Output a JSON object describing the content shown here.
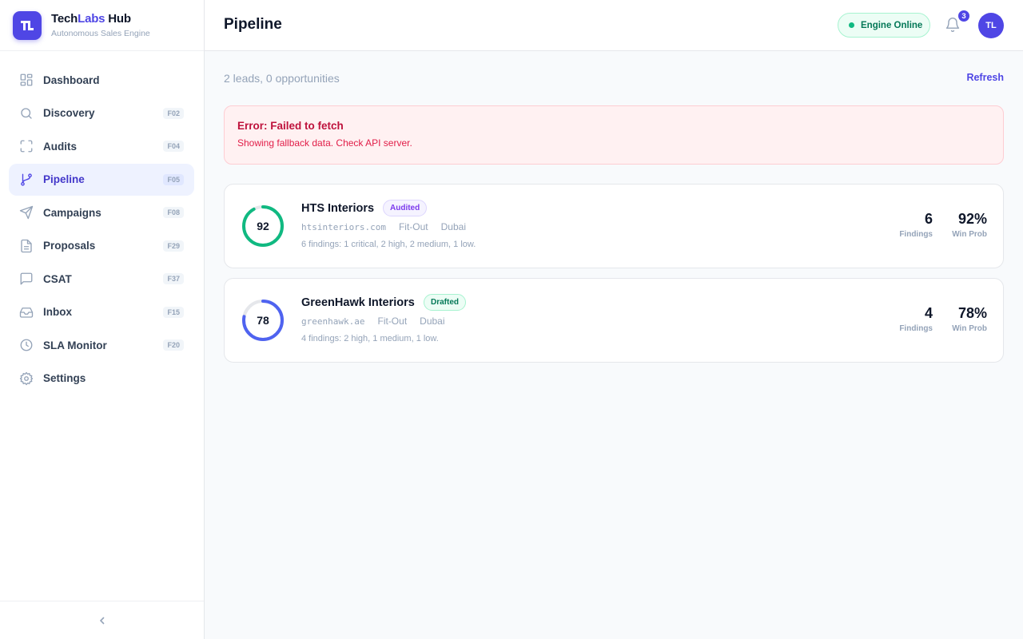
{
  "brand": {
    "name_part1": "Tech",
    "name_accent": "Labs",
    "name_part2": " Hub",
    "subtitle": "Autonomous Sales Engine",
    "logo_text": "TL"
  },
  "sidebar": {
    "items": [
      {
        "label": "Dashboard",
        "kbd": "",
        "icon": "dashboard-icon"
      },
      {
        "label": "Discovery",
        "kbd": "F02",
        "icon": "search-icon"
      },
      {
        "label": "Audits",
        "kbd": "F04",
        "icon": "scan-icon"
      },
      {
        "label": "Pipeline",
        "kbd": "F05",
        "icon": "git-branch-icon",
        "active": true
      },
      {
        "label": "Campaigns",
        "kbd": "F08",
        "icon": "send-icon"
      },
      {
        "label": "Proposals",
        "kbd": "F29",
        "icon": "file-text-icon"
      },
      {
        "label": "CSAT",
        "kbd": "F37",
        "icon": "message-square-icon"
      },
      {
        "label": "Inbox",
        "kbd": "F15",
        "icon": "inbox-icon"
      },
      {
        "label": "SLA Monitor",
        "kbd": "F20",
        "icon": "clock-icon"
      },
      {
        "label": "Settings",
        "kbd": "",
        "icon": "gear-icon"
      }
    ],
    "collapse_icon": "chevron-left-icon"
  },
  "header": {
    "title": "Pipeline",
    "status": "Engine Online",
    "notifications": "3",
    "avatar": "TL"
  },
  "main": {
    "summary": "2 leads, 0 opportunities",
    "refresh_label": "Refresh",
    "error": {
      "title": "Error: Failed to fetch",
      "message": "Showing fallback data. Check API server."
    },
    "leads": [
      {
        "score": "92",
        "score_value": 92,
        "ring_color": "#10b981",
        "name": "HTS Interiors",
        "status": "Audited",
        "domain": "htsinteriors.com",
        "sector": "Fit-Out",
        "city": "Dubai",
        "summary": "6 findings: 1 critical, 2 high, 2 medium, 1 low.",
        "findings": "6",
        "findings_label": "Findings",
        "win_prob": "92%",
        "win_prob_label": "Win Prob"
      },
      {
        "score": "78",
        "score_value": 78,
        "ring_color": "#4f63f0",
        "name": "GreenHawk Interiors",
        "status": "Drafted",
        "domain": "greenhawk.ae",
        "sector": "Fit-Out",
        "city": "Dubai",
        "summary": "4 findings: 2 high, 1 medium, 1 low.",
        "findings": "4",
        "findings_label": "Findings",
        "win_prob": "78%",
        "win_prob_label": "Win Prob"
      }
    ]
  },
  "colors": {
    "accent": "#4f46e5",
    "success": "#10b981",
    "error": "#be123c"
  }
}
